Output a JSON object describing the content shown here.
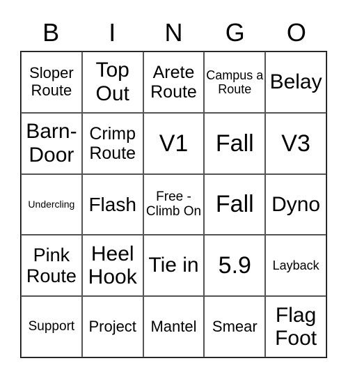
{
  "header": [
    "B",
    "I",
    "N",
    "G",
    "O"
  ],
  "cells": [
    [
      "Sloper Route",
      "Top Out",
      "Arete Route",
      "Campus a Route",
      "Belay"
    ],
    [
      "Barn- Door",
      "Crimp Route",
      "V1",
      "Fall",
      "V3"
    ],
    [
      "Undercling",
      "Flash",
      "Free - Climb On",
      "Fall",
      "Dyno"
    ],
    [
      "Pink Route",
      "Heel Hook",
      "Tie in",
      "5.9",
      "Layback"
    ],
    [
      "Support",
      "Project",
      "Mantel",
      "Smear",
      "Flag Foot"
    ]
  ]
}
